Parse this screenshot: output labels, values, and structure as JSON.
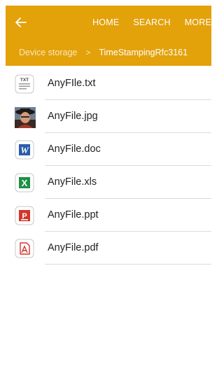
{
  "topbar": {
    "back_label": "back",
    "nav": [
      "HOME",
      "SEARCH",
      "MORE"
    ],
    "color": "#e3a10a"
  },
  "breadcrumb": {
    "root": "Device storage",
    "separator": ">",
    "current": "TimeStampingRfc3161"
  },
  "files": [
    {
      "name": "AnyFIle.txt",
      "icon": "txt-file-icon"
    },
    {
      "name": "AnyFile.jpg",
      "icon": "jpg-thumbnail"
    },
    {
      "name": "AnyFile.doc",
      "icon": "word-doc-icon"
    },
    {
      "name": "AnyFile.xls",
      "icon": "excel-xls-icon"
    },
    {
      "name": "AnyFile.ppt",
      "icon": "powerpoint-ppt-icon"
    },
    {
      "name": "AnyFile.pdf",
      "icon": "pdf-file-icon"
    }
  ]
}
